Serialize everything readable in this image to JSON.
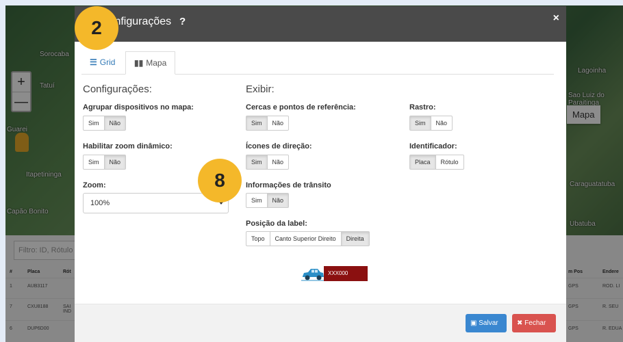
{
  "background": {
    "map_labels": [
      "Sorocaba",
      "Tatuí",
      "Itapetininga",
      "Guarei",
      "Capão Bonito",
      "Sao Luiz do Paraitinga",
      "Lagoinha",
      "Ubatuba",
      "Caraguatatuba"
    ],
    "zoom_in": "+",
    "zoom_out": "—",
    "map_type": "Mapa",
    "filter_placeholder": "Filtro: ID, Rótulo",
    "table_headers": [
      "#",
      "Placa",
      "Rót",
      "m Pos",
      "Endere"
    ],
    "rows": [
      {
        "num": "1",
        "placa": "AUB3117",
        "pos": "GPS",
        "end": "ROD. LI"
      },
      {
        "num": "7",
        "placa": "CXU8188",
        "rot": "SAI IND",
        "pos": "GPS",
        "end": "R. SEU"
      },
      {
        "num": "6",
        "placa": "DUP6D00",
        "pos": "GPS",
        "end": "R. EDUA"
      }
    ]
  },
  "modal": {
    "title": "Configurações",
    "help": "?",
    "close": "×",
    "tabs": [
      {
        "label": "Grid",
        "icon": "list-icon"
      },
      {
        "label": "Mapa",
        "icon": "map-icon"
      }
    ],
    "left_section_title": "Configurações:",
    "right_section_title": "Exibir:",
    "fields": {
      "agrupar": {
        "label": "Agrupar dispositivos no mapa:",
        "options": [
          "Sim",
          "Não"
        ],
        "selected": "Não"
      },
      "zoom_dinamico": {
        "label": "Habilitar zoom dinâmico:",
        "options": [
          "Sim",
          "Não"
        ],
        "selected": "Não"
      },
      "zoom": {
        "label": "Zoom:",
        "value": "100%"
      },
      "cercas": {
        "label": "Cercas e pontos de referência:",
        "options": [
          "Sim",
          "Não"
        ],
        "selected": "Sim"
      },
      "icones": {
        "label": "Ícones de direção:",
        "options": [
          "Sim",
          "Não"
        ],
        "selected": "Sim"
      },
      "transito": {
        "label": "Informações de trânsito",
        "options": [
          "Sim",
          "Não"
        ],
        "selected": "Não"
      },
      "posicao": {
        "label": "Posição da label:",
        "options": [
          "Topo",
          "Canto Superior Direito",
          "Direita"
        ],
        "selected": "Direita"
      },
      "rastro": {
        "label": "Rastro:",
        "options": [
          "Sim",
          "Não"
        ],
        "selected": "Sim"
      },
      "identificador": {
        "label": "Identificador:",
        "options": [
          "Placa",
          "Rótulo"
        ],
        "selected": "Placa"
      }
    },
    "preview_plate": "XXX000",
    "save_label": "Salvar",
    "close_label": "Fechar"
  },
  "badges": {
    "b1": "2",
    "b2": "8"
  },
  "colors": {
    "accent": "#337ab7",
    "save": "#3a87d0",
    "danger": "#d9534f",
    "badge": "#f4b82a",
    "plate": "#8b1010"
  }
}
